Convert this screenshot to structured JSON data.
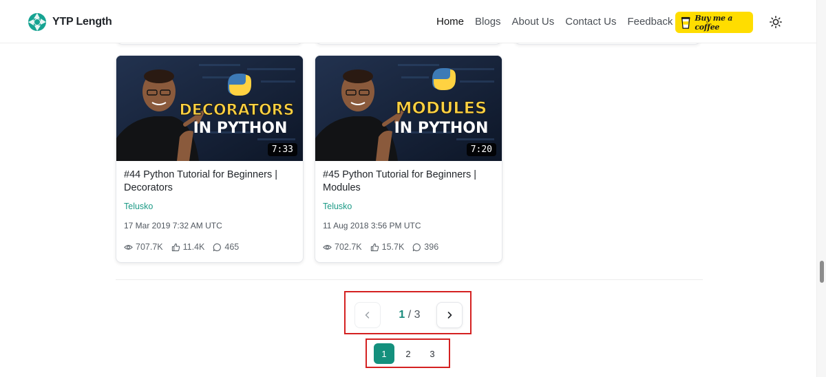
{
  "brand": {
    "name": "YTP Length"
  },
  "nav": {
    "items": [
      {
        "label": "Home",
        "active": true
      },
      {
        "label": "Blogs",
        "active": false
      },
      {
        "label": "About Us",
        "active": false
      },
      {
        "label": "Contact Us",
        "active": false
      },
      {
        "label": "Feedback",
        "active": false
      }
    ],
    "coffee_label": "Buy me a coffee",
    "theme_icon": "sun-icon"
  },
  "videos": [
    {
      "title": "#44 Python Tutorial for Beginners | Decorators",
      "channel": "Telusko",
      "date": "17 Mar 2019 7:32 AM UTC",
      "duration": "7:33",
      "views": "707.7K",
      "likes": "11.4K",
      "comments": "465",
      "thumb_line1": "DECORATORS",
      "thumb_line2": "IN PYTHON"
    },
    {
      "title": "#45 Python Tutorial for Beginners | Modules",
      "channel": "Telusko",
      "date": "11 Aug 2018 3:56 PM UTC",
      "duration": "7:20",
      "views": "702.7K",
      "likes": "15.7K",
      "comments": "396",
      "thumb_line1": "MODULES",
      "thumb_line2": "IN PYTHON"
    }
  ],
  "pagination": {
    "current": "1",
    "separator": "/",
    "total": "3",
    "pages": [
      "1",
      "2",
      "3"
    ]
  },
  "colors": {
    "accent": "#14907d",
    "coffee": "#ffdd00",
    "highlight_border": "#d42020"
  }
}
